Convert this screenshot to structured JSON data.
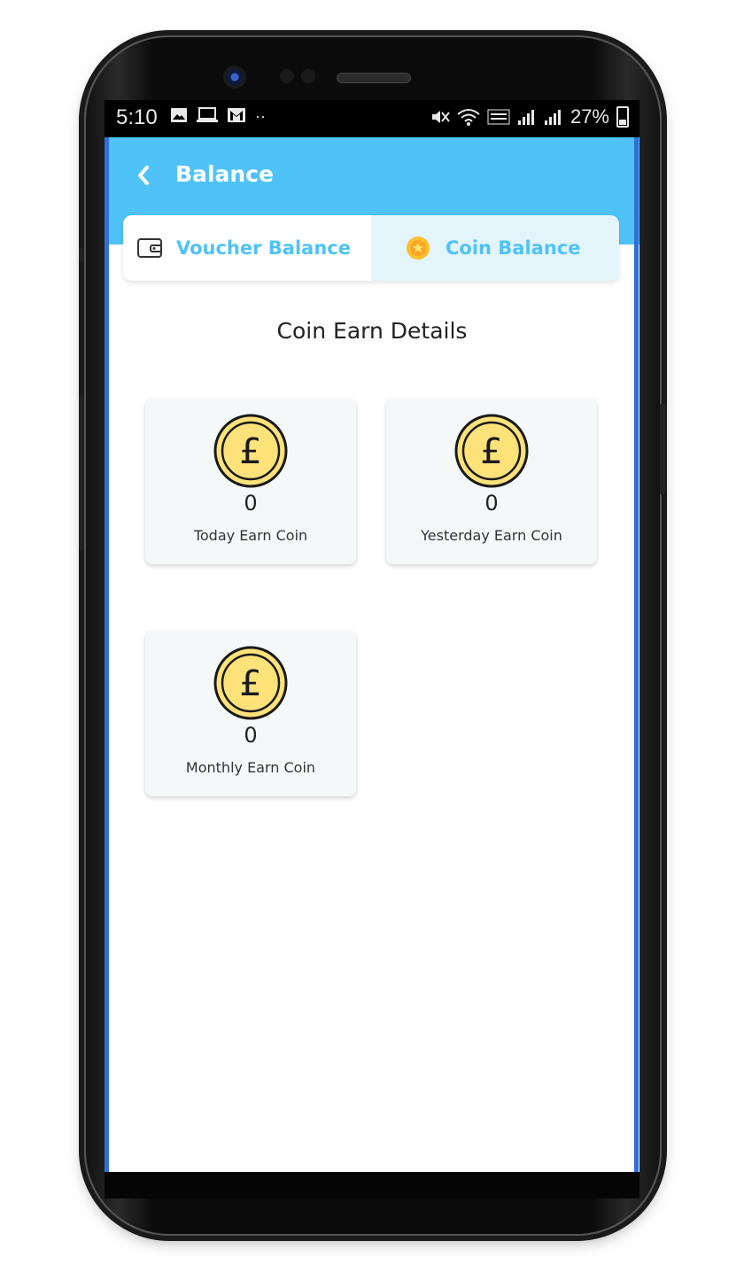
{
  "status_bar": {
    "time": "5:10",
    "battery": "27%"
  },
  "header": {
    "title": "Balance",
    "back_icon": "chevron-left-icon"
  },
  "tabs": [
    {
      "label": "Voucher Balance",
      "icon": "wallet-icon",
      "selected": false
    },
    {
      "label": "Coin Balance",
      "icon": "coin-icon",
      "selected": true
    }
  ],
  "section_title": "Coin Earn Details",
  "cards": [
    {
      "value": "0",
      "label": "Today Earn Coin"
    },
    {
      "value": "0",
      "label": "Yesterday Earn Coin"
    },
    {
      "value": "0",
      "label": "Monthly Earn Coin"
    }
  ],
  "colors": {
    "app_bar": "#4fc3f7",
    "tab_active_bg": "#e3f4fb",
    "coin_fill": "#fde27a",
    "card_bg": "#f5f8f9"
  }
}
